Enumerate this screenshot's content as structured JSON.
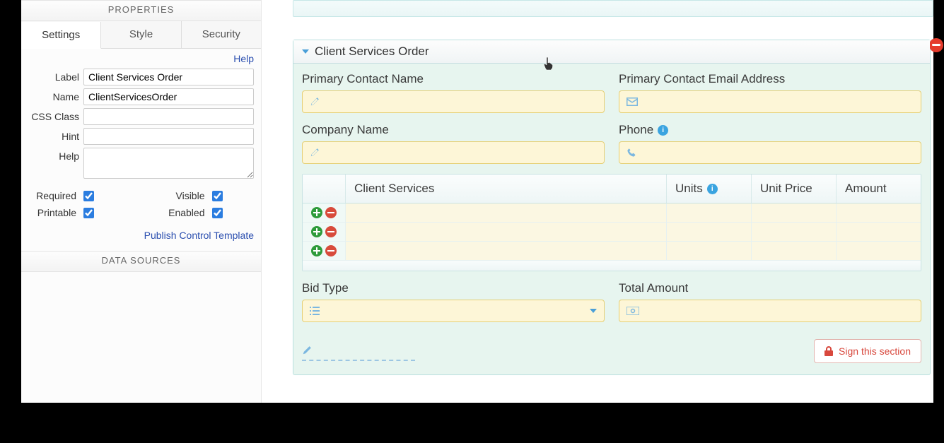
{
  "sidebar": {
    "properties_header": "PROPERTIES",
    "tabs": {
      "settings": "Settings",
      "style": "Style",
      "security": "Security"
    },
    "help_link": "Help",
    "fields": {
      "label_lbl": "Label",
      "label_val": "Client Services Order",
      "name_lbl": "Name",
      "name_val": "ClientServicesOrder",
      "css_lbl": "CSS Class",
      "css_val": "",
      "hint_lbl": "Hint",
      "hint_val": "",
      "help_lbl": "Help",
      "help_val": ""
    },
    "checks": {
      "required_lbl": "Required",
      "required_val": true,
      "visible_lbl": "Visible",
      "visible_val": true,
      "printable_lbl": "Printable",
      "printable_val": true,
      "enabled_lbl": "Enabled",
      "enabled_val": true
    },
    "publish_link": "Publish Control Template",
    "datasources_header": "DATA SOURCES"
  },
  "canvas": {
    "section_title": "Client Services Order",
    "fields": {
      "contact_name": "Primary Contact Name",
      "contact_email": "Primary Contact Email Address",
      "company": "Company Name",
      "phone": "Phone",
      "bid_type": "Bid Type",
      "total_amount": "Total Amount"
    },
    "table": {
      "cols": {
        "services": "Client Services",
        "units": "Units",
        "unit_price": "Unit Price",
        "amount": "Amount"
      },
      "row_count": 3
    },
    "sign_button": "Sign this section"
  }
}
